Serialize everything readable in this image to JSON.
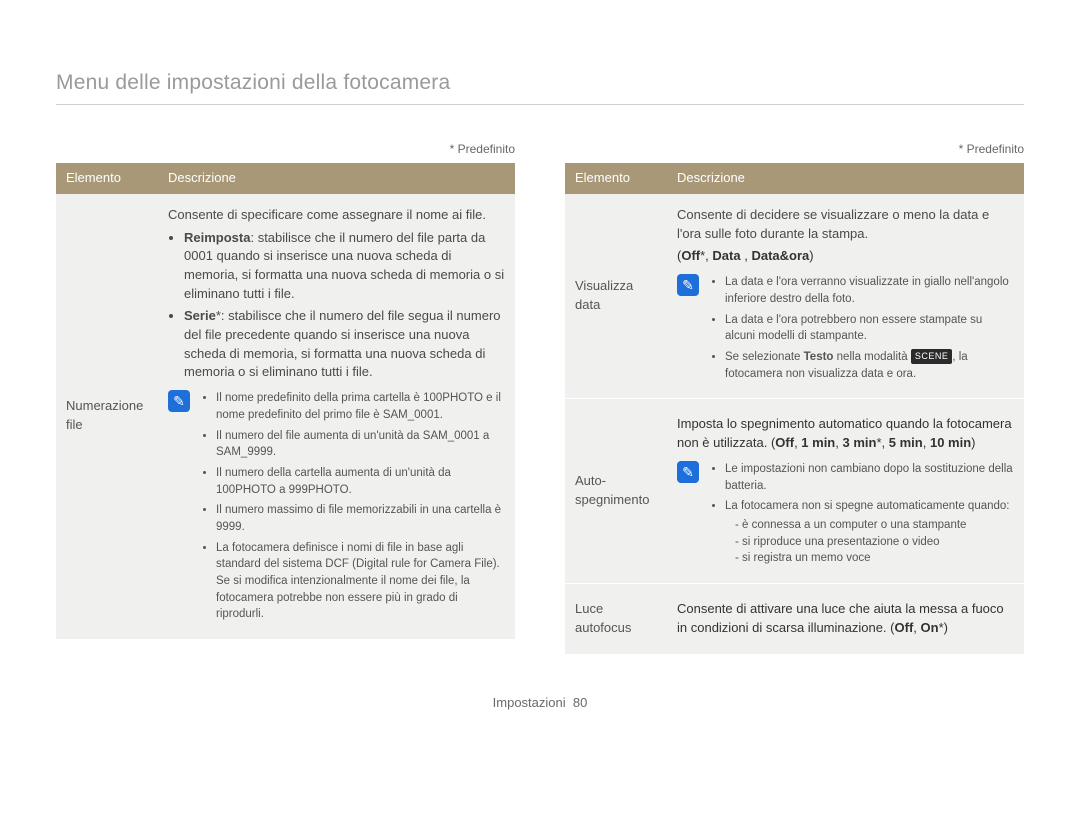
{
  "page_title": "Menu delle impostazioni della fotocamera",
  "predef_label": "* Predefinito",
  "header": {
    "elemento": "Elemento",
    "descrizione": "Descrizione"
  },
  "footer": {
    "section": "Impostazioni",
    "page": "80"
  },
  "note_icon": "✎",
  "scene_badge": "SCENE",
  "left": {
    "row1": {
      "label": "Numerazione file",
      "intro": "Consente di specificare come assegnare il nome ai file.",
      "b1_label": "Reimposta",
      "b1_text": ": stabilisce che il numero del file parta da 0001 quando si inserisce una nuova scheda di memoria, si formatta una nuova scheda di memoria o si eliminano tutti i file.",
      "b2_label": "Serie",
      "b2_text": "*: stabilisce che il numero del file segua il numero del file precedente quando si inserisce una nuova scheda di memoria, si formatta una nuova scheda di memoria o si eliminano tutti i file.",
      "notes": {
        "n1": "Il nome predefinito della prima cartella è 100PHOTO e il nome predefinito del primo file è SAM_0001.",
        "n2": "Il numero del file aumenta di un'unità da SAM_0001 a SAM_9999.",
        "n3": "Il numero della cartella aumenta di un'unità da 100PHOTO a 999PHOTO.",
        "n4": "Il numero massimo di file memorizzabili in una cartella è 9999.",
        "n5": "La fotocamera definisce i nomi di file in base agli standard del sistema DCF (Digital rule for Camera File). Se si modifica intenzionalmente il nome dei file, la fotocamera potrebbe non essere più in grado di riprodurli."
      }
    }
  },
  "right": {
    "row1": {
      "label": "Visualizza data",
      "intro": "Consente di decidere se visualizzare o meno la data e l'ora sulle foto durante la stampa.",
      "opts_pre": "(",
      "opts_off": "Off",
      "opts_sep1": "*, ",
      "opts_data": "Data",
      "opts_sep2": " , ",
      "opts_dataora": "Data&ora",
      "opts_post": ")",
      "notes": {
        "n1": "La data e l'ora verranno visualizzate in giallo nell'angolo inferiore destro della foto.",
        "n2": "La data e l'ora potrebbero non essere stampate su alcuni modelli di stampante.",
        "n3a": "Se selezionate ",
        "n3b": "Testo",
        "n3c": " nella modalità ",
        "n3d": ", la fotocamera non visualizza data e ora."
      }
    },
    "row2": {
      "label": "Auto-spegnimento",
      "intro_a": "Imposta lo spegnimento automatico quando la fotocamera non è utilizzata. (",
      "o_off": "Off",
      "s1": ", ",
      "o_1": "1 min",
      "s2": ", ",
      "o_3": "3 min",
      "s3": "*, ",
      "o_5": "5 min",
      "s4": ", ",
      "o_10": "10 min",
      "close": ")",
      "notes": {
        "n1": "Le impostazioni non cambiano dopo la sostituzione della batteria.",
        "n2": "La fotocamera non si spegne automaticamente quando:",
        "s1": "è connessa a un computer o una stampante",
        "s2": "si riproduce una presentazione o video",
        "s3": "si registra un memo voce"
      }
    },
    "row3": {
      "label": "Luce autofocus",
      "text_a": "Consente di attivare una luce che aiuta la messa a fuoco in condizioni di scarsa illuminazione. (",
      "o_off": "Off",
      "sep": ", ",
      "o_on": "On",
      "close": "*)"
    }
  }
}
